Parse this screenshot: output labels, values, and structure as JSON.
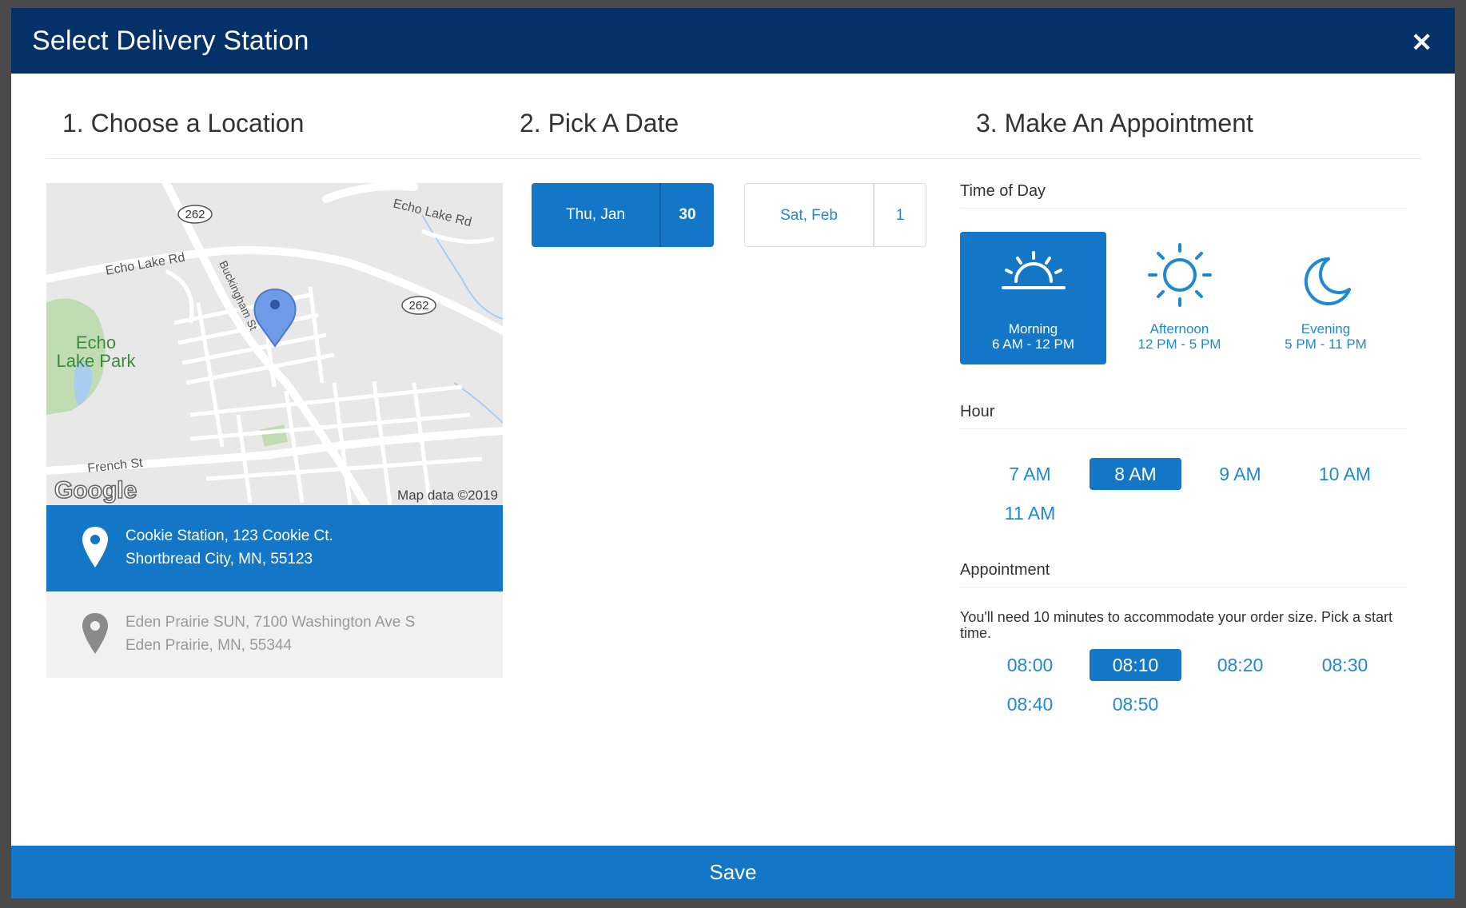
{
  "modal": {
    "title": "Select Delivery Station",
    "close_icon": "close-icon"
  },
  "columns": {
    "location": "1. Choose a Location",
    "date": "2. Pick A Date",
    "appointment": "3. Make An Appointment"
  },
  "map": {
    "roads": [
      "Echo Lake Rd",
      "Echo Lake Rd",
      "Buckingham St",
      "French St"
    ],
    "shields": [
      "262",
      "262"
    ],
    "park": "Echo Lake Park",
    "brand": "Google",
    "attribution": "Map data ©2019"
  },
  "locations": [
    {
      "line1": "Cookie Station, 123 Cookie Ct.",
      "line2": "Shortbread City, MN, 55123",
      "selected": true
    },
    {
      "line1": "Eden Prairie SUN, 7100 Washington Ave S",
      "line2": "Eden Prairie, MN, 55344",
      "selected": false
    }
  ],
  "dates": [
    {
      "label": "Thu, Jan",
      "day": "30",
      "selected": true
    },
    {
      "label": "Sat, Feb",
      "day": "1",
      "selected": false
    }
  ],
  "time_of_day": {
    "heading": "Time of Day",
    "options": [
      {
        "name": "Morning",
        "range": "6 AM - 12 PM",
        "icon": "sunrise-icon",
        "selected": true
      },
      {
        "name": "Afternoon",
        "range": "12 PM - 5 PM",
        "icon": "sun-icon",
        "selected": false
      },
      {
        "name": "Evening",
        "range": "5 PM - 11 PM",
        "icon": "moon-icon",
        "selected": false
      }
    ]
  },
  "hour": {
    "heading": "Hour",
    "options": [
      "7 AM",
      "8 AM",
      "9 AM",
      "10 AM",
      "11 AM"
    ],
    "selected": "8 AM"
  },
  "appointment": {
    "heading": "Appointment",
    "note": "You'll need 10 minutes to accommodate your order size. Pick a start time.",
    "options": [
      "08:00",
      "08:10",
      "08:20",
      "08:30",
      "08:40",
      "08:50"
    ],
    "selected": "08:10"
  },
  "save_label": "Save",
  "colors": {
    "header": "#043168",
    "accent": "#1476c6",
    "link": "#1e88d4"
  }
}
